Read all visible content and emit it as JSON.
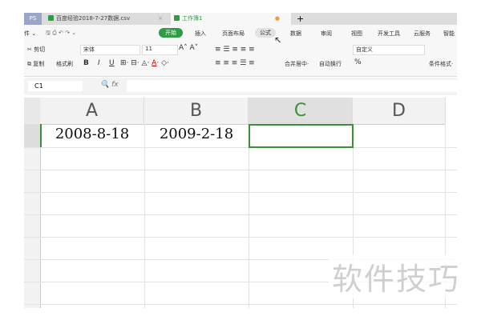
{
  "tabs": [
    {
      "label": "PS"
    },
    {
      "label": "百度经验2018-7-27数据.csv",
      "close": "×"
    },
    {
      "label": "工作簿1"
    }
  ],
  "new_tab": "+",
  "menu": {
    "file": "件 ⌄",
    "items": [
      "开始",
      "插入",
      "页面布局",
      "公式",
      "数据",
      "审阅",
      "视图",
      "开发工具",
      "云服务",
      "智能"
    ]
  },
  "toolbar": {
    "cut": "剪切",
    "copy": "复制",
    "format_painter": "格式刷",
    "font": "宋体",
    "size": "11",
    "merge": "合并居中·",
    "wrap": "自动换行",
    "number_format": "自定义",
    "cond_format": "条件格式·",
    "bold": "B",
    "italic": "I",
    "underline": "U",
    "percent": "%"
  },
  "formula_bar": {
    "name_box": "C1",
    "fx": "fx",
    "value": ""
  },
  "columns": [
    "A",
    "B",
    "C",
    "D"
  ],
  "cells": {
    "A1": "2008-8-18",
    "B1": "2009-2-18",
    "C1": ""
  },
  "watermark": "软件技巧",
  "colors": {
    "accent": "#2e9b45",
    "selected_border": "#3a8f3a"
  }
}
